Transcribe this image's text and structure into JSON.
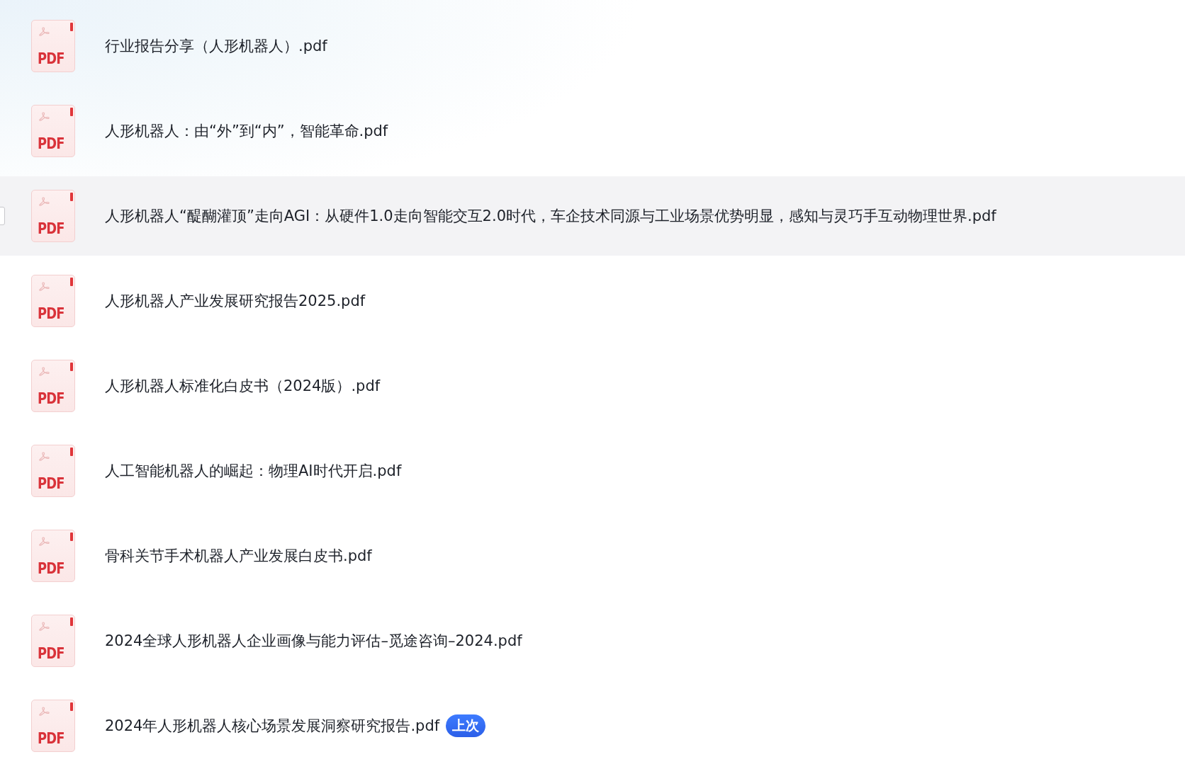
{
  "files": [
    {
      "name": "行业报告分享（人形机器人）.pdf",
      "icon_label": "PDF",
      "hovered": false
    },
    {
      "name": "人形机器人：由“外”到“内”，智能革命.pdf",
      "icon_label": "PDF",
      "hovered": false
    },
    {
      "name": "人形机器人“醍醐灌顶”走向AGI：从硬件1.0走向智能交互2.0时代，车企技术同源与工业场景优势明显，感知与灵巧手互动物理世界.pdf",
      "icon_label": "PDF",
      "hovered": true
    },
    {
      "name": "人形机器人产业发展研究报告2025.pdf",
      "icon_label": "PDF",
      "hovered": false
    },
    {
      "name": "人形机器人标准化白皮书（2024版）.pdf",
      "icon_label": "PDF",
      "hovered": false
    },
    {
      "name": "人工智能机器人的崛起：物理AI时代开启.pdf",
      "icon_label": "PDF",
      "hovered": false
    },
    {
      "name": "骨科关节手术机器人产业发展白皮书.pdf",
      "icon_label": "PDF",
      "hovered": false
    },
    {
      "name": "2024全球人形机器人企业画像与能力评估–觅途咨询–2024.pdf",
      "icon_label": "PDF",
      "hovered": false
    },
    {
      "name": "2024年人形机器人核心场景发展洞察研究报告.pdf",
      "icon_label": "PDF",
      "hovered": false,
      "badge": "上次"
    }
  ]
}
